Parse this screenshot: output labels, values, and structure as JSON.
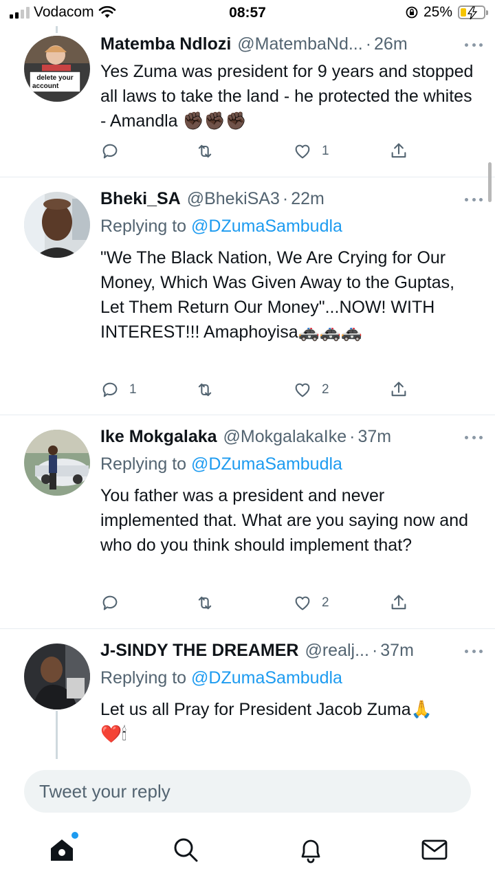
{
  "status_bar": {
    "carrier": "Vodacom",
    "time": "08:57",
    "battery_percent": "25%",
    "battery_level": 0.25
  },
  "tweets": [
    {
      "name": "Matemba Ndlozi",
      "handle": "@MatembaNd...",
      "time": "26m",
      "avatar_sign_text": "delete your account",
      "replying_to": "",
      "text": "Yes Zuma was president for 9 years and stopped all laws to take the land  - he protected the whites - Amandla",
      "text_emoji": "✊🏿✊🏿✊🏿",
      "replies": "",
      "retweets": "",
      "likes": "1"
    },
    {
      "name": "Bheki_SA",
      "handle": "@BhekiSA3",
      "time": "22m",
      "replying_prefix": "Replying to",
      "replying_to": "@DZumaSambudla",
      "text": "\"We The Black Nation, We Are Crying for Our Money, Which Was Given Away to the Guptas, Let Them Return Our Money\"...NOW! WITH INTEREST!!! Amaphoyisa",
      "text_emoji": "🚓🚓🚓",
      "replies": "1",
      "retweets": "",
      "likes": "2"
    },
    {
      "name": "Ike Mokgalaka",
      "handle": "@MokgalakaIke",
      "time": "37m",
      "replying_prefix": "Replying to",
      "replying_to": "@DZumaSambudla",
      "text": "You father was a president and never implemented that. What are you saying now and who do you think should implement that?",
      "text_emoji": "",
      "replies": "",
      "retweets": "",
      "likes": "2"
    },
    {
      "name": "J-SINDY THE DREAMER",
      "handle": "@realj...",
      "time": "37m",
      "replying_prefix": "Replying to",
      "replying_to": "@DZumaSambudla",
      "text": "Let us all Pray for President Jacob Zuma",
      "text_emoji": "🙏",
      "text_emoji_2": "❤️🕯",
      "replies": "",
      "retweets": "",
      "likes": ""
    }
  ],
  "reply_box": {
    "placeholder": "Tweet your reply"
  },
  "nav": {
    "icons": [
      "home-icon",
      "search-icon",
      "notifications-icon",
      "messages-icon"
    ]
  },
  "colors": {
    "accent": "#1d9bf0",
    "text": "#0f1419",
    "secondary": "#536471",
    "divider": "#e6ecf0"
  }
}
